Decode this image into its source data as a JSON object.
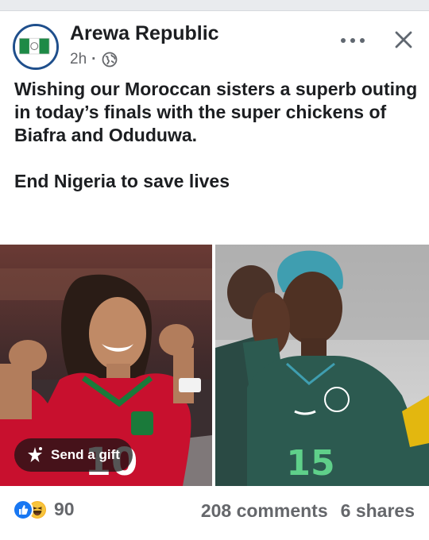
{
  "post": {
    "page_name": "Arewa Republic",
    "time": "2h",
    "separator": "·",
    "audience_icon": "globe-icon",
    "text_lines": [
      "Wishing our Moroccan sisters a superb outing in today’s finals with the super chickens of Biafra and Oduduwa.",
      "End Nigeria to save lives"
    ]
  },
  "header_actions": {
    "more_icon": "more-horizontal-icon",
    "close_icon": "close-icon"
  },
  "photos": {
    "left": {
      "jersey_number": "10"
    },
    "right": {
      "jersey_number": "15"
    }
  },
  "gift": {
    "label": "Send a gift",
    "icon": "gift-icon"
  },
  "engagement": {
    "reaction_icons": [
      "like-icon",
      "haha-icon"
    ],
    "reaction_count": "90",
    "comments": "208 comments",
    "shares": "6 shares"
  },
  "colors": {
    "accent_blue": "#1877f2",
    "secondary_text": "#65676b",
    "morocco_red": "#c8102e",
    "nigeria_green": "#1f5a4c"
  }
}
